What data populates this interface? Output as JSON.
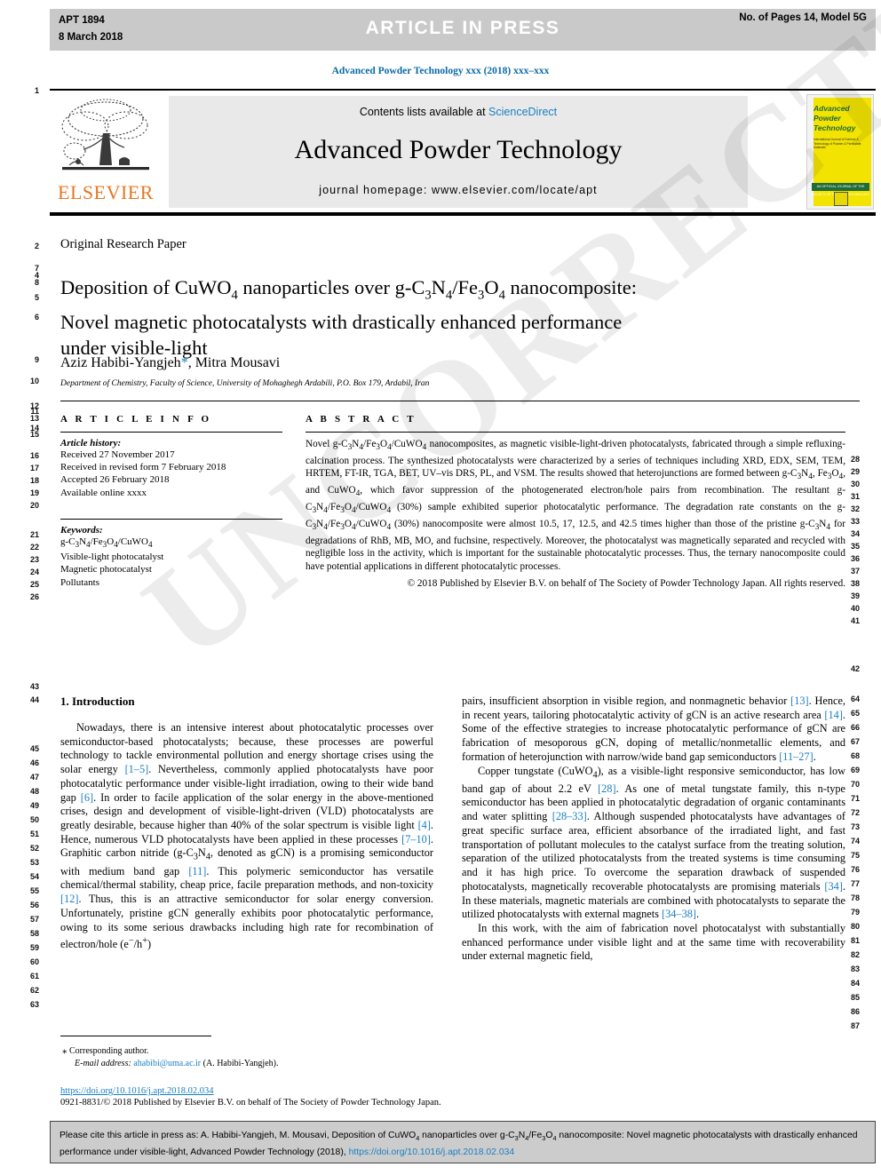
{
  "press_banner": {
    "code": "APT 1894",
    "date": "8 March 2018",
    "center": "ARTICLE  IN  PRESS",
    "right": "No. of Pages 14, Model 5G"
  },
  "running_head": "Advanced Powder Technology xxx (2018) xxx–xxx",
  "masthead": {
    "publisher": "ELSEVIER",
    "contents_prefix": "Contents lists available at ",
    "contents_link": "ScienceDirect",
    "journal_title": "Advanced Powder Technology",
    "homepage": "journal homepage: www.elsevier.com/locate/apt",
    "cover": {
      "title_l1": "Advanced",
      "title_l2": "Powder",
      "title_l3": "Technology",
      "subtitle": "International Journal of Science & Technology of Powder & Particulate Materials",
      "band": "AN OFFICIAL JOURNAL OF THE SOCIETY OF POWDER TECHNOLOGY JAPAN"
    }
  },
  "article": {
    "type": "Original Research Paper",
    "title_line1_a": "Deposition of CuWO",
    "title_line1_sub1": "4",
    "title_line1_b": " nanoparticles over g-C",
    "title_line1_sub2": "3",
    "title_line1_c": "N",
    "title_line1_sub3": "4",
    "title_line1_d": "/Fe",
    "title_line1_sub4": "3",
    "title_line1_e": "O",
    "title_line1_sub5": "4",
    "title_line1_f": " nanocomposite:",
    "title_line2": "Novel magnetic photocatalysts with drastically enhanced performance",
    "title_line3": "under visible-light",
    "authors_a": "Aziz Habibi-Yangjeh",
    "authors_star": "*",
    "authors_b": ", Mitra Mousavi",
    "affiliation": "Department of Chemistry, Faculty of Science, University of Mohaghegh Ardabili, P.O. Box 179, Ardabil, Iran"
  },
  "info": {
    "heading": "A R T I C L E  I N F O",
    "history_label": "Article history:",
    "history": [
      "Received 27 November 2017",
      "Received in revised form 7 February 2018",
      "Accepted 26 February 2018",
      "Available online xxxx"
    ],
    "keywords_label": "Keywords:",
    "keywords": [
      "g-C3N4/Fe3O4/CuWO4",
      "Visible-light photocatalyst",
      "Magnetic photocatalyst",
      "Pollutants"
    ]
  },
  "abstract": {
    "heading": "A B S T R A C T",
    "body": "Novel g-C3N4/Fe3O4/CuWO4 nanocomposites, as magnetic visible-light-driven photocatalysts, fabricated through a simple refluxing-calcination process. The synthesized photocatalysts were characterized by a series of techniques including XRD, EDX, SEM, TEM, HRTEM, FT-IR, TGA, BET, UV–vis DRS, PL, and VSM. The results showed that heterojunctions are formed between g-C3N4, Fe3O4, and CuWO4, which favor suppression of the photogenerated electron/hole pairs from recombination. The resultant g-C3N4/Fe3O4/CuWO4 (30%) sample exhibited superior photocatalytic performance. The degradation rate constants on the g-C3N4/Fe3O4/CuWO4 (30%) nanocomposite were almost 10.5, 17, 12.5, and 42.5 times higher than those of the pristine g-C3N4 for degradations of RhB, MB, MO, and fuchsine, respectively. Moreover, the photocatalyst was magnetically separated and recycled with negligible loss in the activity, which is important for the sustainable photocatalytic processes. Thus, the ternary nanocomposite could have potential applications in different photocatalytic processes.",
    "copyright": "© 2018 Published by Elsevier B.V. on behalf of The Society of Powder Technology Japan. All rights reserved."
  },
  "body": {
    "section_title": "1. Introduction",
    "left_p1": "Nowadays, there is an intensive interest about photocatalytic processes over semiconductor-based photocatalysts; because, these processes are powerful technology to tackle environmental pollution and energy shortage crises using the solar energy [1–5]. Nevertheless, commonly applied photocatalysts have poor photocatalytic performance under visible-light irradiation, owing to their wide band gap [6]. In order to facile application of the solar energy in the above-mentioned crises, design and development of visible-light-driven (VLD) photocatalysts are greatly desirable, because higher than 40% of the solar spectrum is visible light [4]. Hence, numerous VLD photocatalysts have been applied in these processes [7–10]. Graphitic carbon nitride (g-C3N4, denoted as gCN) is a promising semiconductor with medium band gap [11]. This polymeric semiconductor has versatile chemical/thermal stability, cheap price, facile preparation methods, and non-toxicity [12]. Thus, this is an attractive semiconductor for solar energy conversion. Unfortunately, pristine gCN generally exhibits poor photocatalytic performance, owing to its some serious drawbacks including high rate for recombination of electron/hole (e−/h+)",
    "right_p1": "pairs, insufficient absorption in visible region, and nonmagnetic behavior [13]. Hence, in recent years, tailoring photocatalytic activity of gCN is an active research area [14]. Some of the effective strategies to increase photocatalytic performance of gCN are fabrication of mesoporous gCN, doping of metallic/nonmetallic elements, and formation of heterojunction with narrow/wide band gap semiconductors [11–27].",
    "right_p2": "Copper tungstate (CuWO4), as a visible-light responsive semiconductor, has low band gap of about 2.2 eV [28]. As one of metal tungstate family, this n-type semiconductor has been applied in photocatalytic degradation of organic contaminants and water splitting [28–33]. Although suspended photocatalysts have advantages of great specific surface area, efficient absorbance of the irradiated light, and fast transportation of pollutant molecules to the catalyst surface from the treating solution, separation of the utilized photocatalysts from the treated systems is time consuming and it has high price. To overcome the separation drawback of suspended photocatalysts, magnetically recoverable photocatalysts are promising materials [34]. In these materials, magnetic materials are combined with photocatalysts to separate the utilized photocatalysts with external magnets [34–38].",
    "right_p3": "In this work, with the aim of fabrication novel photocatalyst with substantially enhanced performance under visible light and at the same time with recoverability under external magnetic field,"
  },
  "footnote": {
    "star": "⁎",
    "corresponding": " Corresponding author.",
    "email_label": "E-mail address:",
    "email": "ahabibi@uma.ac.ir",
    "email_owner": " (A. Habibi-Yangjeh)."
  },
  "doi_block": {
    "doi": "https://doi.org/10.1016/j.apt.2018.02.034",
    "issn": "0921-8831/© 2018 Published by Elsevier B.V. on behalf of The Society of Powder Technology Japan."
  },
  "cite_box": {
    "text_a": "Please cite this article in press as: A. Habibi-Yangjeh, M. Mousavi, Deposition of CuWO",
    "sub_a": "4",
    "text_b": " nanoparticles over g-C",
    "sub_b": "3",
    "text_c": "N",
    "sub_c": "4",
    "text_d": "/Fe",
    "sub_d": "3",
    "text_e": "O",
    "sub_e": "4",
    "text_f": " nanocomposite: Novel magnetic photocatalysts with drastically enhanced performance under visible-light, Advanced Powder Technology (2018), ",
    "link": "https://doi.org/10.1016/j.apt.2018.02.034"
  },
  "line_numbers": {
    "left": [
      "1",
      "2",
      "7",
      "4",
      "8",
      "5",
      "6",
      "9",
      "10",
      "12",
      "11",
      "13",
      "14",
      "15",
      "16",
      "17",
      "18",
      "19",
      "20",
      "21",
      "22",
      "23",
      "24",
      "25",
      "26",
      "43",
      "44",
      "45",
      "46",
      "47",
      "48",
      "49",
      "50",
      "51",
      "52",
      "53",
      "54",
      "55",
      "56",
      "57",
      "58",
      "59",
      "60",
      "61",
      "62",
      "63"
    ],
    "right": [
      "28",
      "29",
      "30",
      "31",
      "32",
      "33",
      "34",
      "35",
      "36",
      "37",
      "38",
      "39",
      "40",
      "41",
      "42",
      "64",
      "65",
      "66",
      "67",
      "68",
      "69",
      "70",
      "71",
      "72",
      "73",
      "74",
      "75",
      "76",
      "77",
      "78",
      "79",
      "80",
      "81",
      "82",
      "83",
      "84",
      "85",
      "86",
      "87"
    ]
  },
  "watermark": "UNCORRECTED PROOF",
  "colors": {
    "link": "#1a7fc1",
    "elsevier_orange": "#e87722",
    "cover_yellow": "#f2e300",
    "banner_gray": "#c9c9c9"
  }
}
